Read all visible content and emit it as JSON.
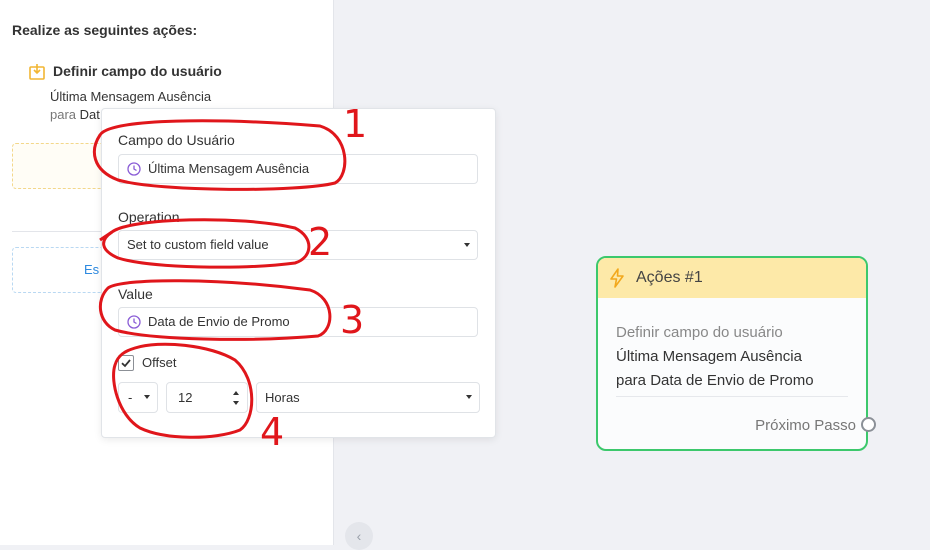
{
  "sidebar": {
    "heading": "Realize as seguintes ações:",
    "action": {
      "title": "Definir campo do usuário",
      "line1": "Última Mensagem Ausência",
      "line2_prefix": "para",
      "line2_value": "Dat"
    },
    "blue_box_text": "Es"
  },
  "popup": {
    "user_field_label": "Campo do Usuário",
    "user_field_value": "Última Mensagem Ausência",
    "operation_label": "Operation",
    "operation_value": "Set to custom field value",
    "value_label": "Value",
    "value_value": "Data de Envio de Promo",
    "offset_label": "Offset",
    "offset_checked": true,
    "offset_sign": "-",
    "offset_amount": "12",
    "offset_unit": "Horas"
  },
  "node": {
    "title": "Ações #1",
    "line1": "Definir campo do usuário",
    "line2": "Última Mensagem Ausência",
    "line3": "para Data de Envio de Promo",
    "next_label": "Próximo Passo"
  },
  "annotations": [
    "1",
    "2",
    "3",
    "4"
  ],
  "colors": {
    "accent_red": "#e0161b",
    "node_border": "#3cc86c",
    "node_header": "#fde9a8",
    "clock_icon": "#8a5cd6"
  }
}
